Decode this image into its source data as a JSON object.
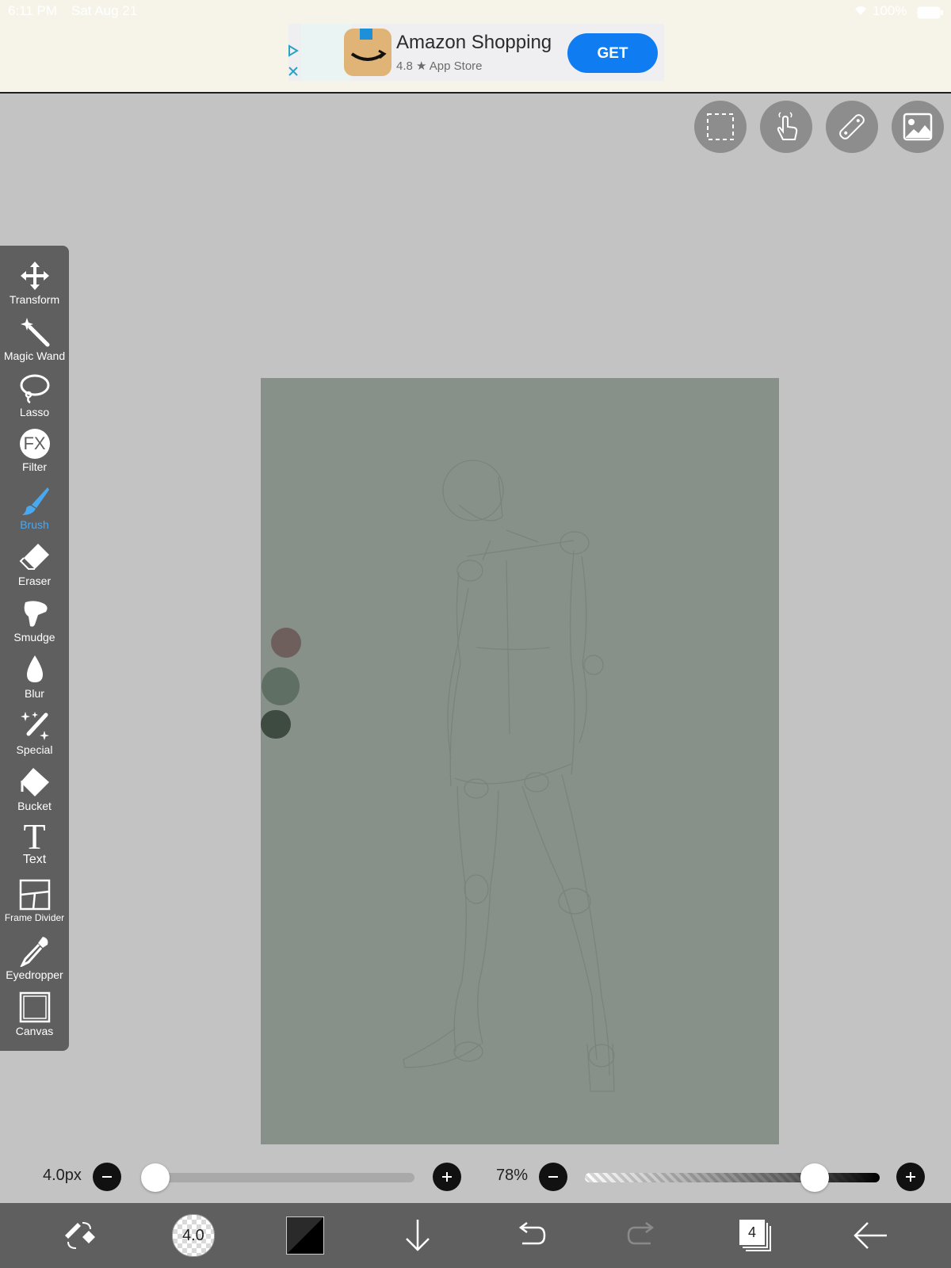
{
  "status": {
    "time": "6:11 PM",
    "date": "Sat Aug 21",
    "battery": "100%"
  },
  "ad": {
    "title": "Amazon Shopping",
    "rating": "4.8 ★ App Store",
    "button": "GET"
  },
  "top_buttons": [
    "selection-icon",
    "hand-gesture-icon",
    "ruler-icon",
    "image-icon"
  ],
  "tools": [
    {
      "id": "transform",
      "label": "Transform",
      "icon": "move-arrows-icon"
    },
    {
      "id": "magic-wand",
      "label": "Magic Wand",
      "icon": "magic-wand-icon"
    },
    {
      "id": "lasso",
      "label": "Lasso",
      "icon": "lasso-icon"
    },
    {
      "id": "filter",
      "label": "Filter",
      "icon": "fx-icon",
      "icon_text": "FX"
    },
    {
      "id": "brush",
      "label": "Brush",
      "icon": "brush-icon",
      "active": true
    },
    {
      "id": "eraser",
      "label": "Eraser",
      "icon": "eraser-icon"
    },
    {
      "id": "smudge",
      "label": "Smudge",
      "icon": "smudge-finger-icon"
    },
    {
      "id": "blur",
      "label": "Blur",
      "icon": "droplet-icon"
    },
    {
      "id": "special",
      "label": "Special",
      "icon": "sparkle-pen-icon"
    },
    {
      "id": "bucket",
      "label": "Bucket",
      "icon": "bucket-icon"
    },
    {
      "id": "text",
      "label": "Text",
      "icon": "text-t-icon",
      "icon_text": "T"
    },
    {
      "id": "frame-divider",
      "label": "Frame Divider",
      "icon": "frame-divider-icon"
    },
    {
      "id": "eyedropper",
      "label": "Eyedropper",
      "icon": "eyedropper-icon"
    },
    {
      "id": "canvas",
      "label": "Canvas",
      "icon": "canvas-square-icon"
    }
  ],
  "palette": [
    "#6e5f5c",
    "#5f6f63",
    "#3e4b41"
  ],
  "canvas_color": "#879089",
  "brush_size": {
    "value": "4.0px",
    "fraction": 0.0
  },
  "opacity": {
    "value": "78%",
    "fraction": 0.78
  },
  "bottom": {
    "brush_preview_label": "4.0",
    "layer_count": "4"
  },
  "colors": {
    "accent": "#4aa8f0",
    "toolbar_bg": "#5f5f5f",
    "ad_button": "#0f7cf2"
  }
}
